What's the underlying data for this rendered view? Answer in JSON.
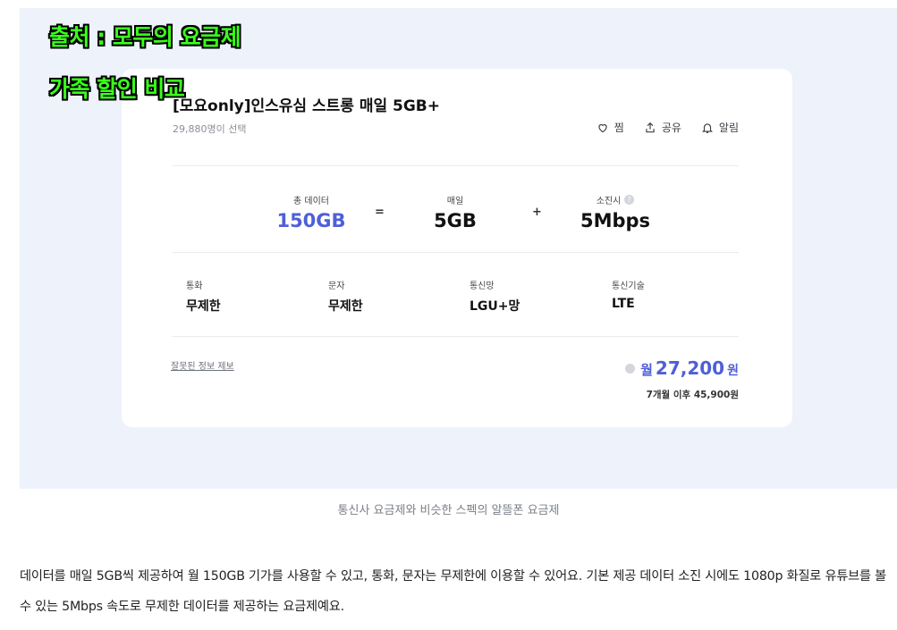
{
  "overlay": {
    "source": "출처 : 모두의 요금제",
    "subtitle": "가족 할인 비교"
  },
  "plan": {
    "title": "[모요only]인스유심 스트롱 매일 5GB+",
    "selected_count": "29,880명이 선택"
  },
  "actions": {
    "like": "찜",
    "share": "공유",
    "alert": "알림"
  },
  "data_stats": {
    "total_label": "총 데이터",
    "total_value": "150GB",
    "equals": "=",
    "daily_label": "매일",
    "daily_value": "5GB",
    "plus": "+",
    "exhausted_label": "소진시",
    "exhausted_value": "5Mbps"
  },
  "specs": [
    {
      "key": "통화",
      "value": "무제한"
    },
    {
      "key": "문자",
      "value": "무제한"
    },
    {
      "key": "통신망",
      "value": "LGU+망"
    },
    {
      "key": "통신기술",
      "value": "LTE"
    }
  ],
  "report_link": "잘못된 정보 제보",
  "price": {
    "prefix": "월",
    "amount": "27,200",
    "unit": "원",
    "after": "7개월 이후 45,900원"
  },
  "caption": "통신사 요금제와 비슷한 스펙의 알뜰폰 요금제",
  "paragraph": "데이터를 매일 5GB씩 제공하여 월 150GB 기가를 사용할 수 있고, 통화, 문자는 무제한에 이용할 수 있어요. 기본 제공 데이터 소진 시에도 1080p 화질로 유튜브를 볼 수 있는 5Mbps 속도로 무제한 데이터를 제공하는 요금제예요.",
  "colors": {
    "accent": "#4f5fd8",
    "overlay_text": "#39ff1a",
    "figure_background": "#eef2fb"
  }
}
